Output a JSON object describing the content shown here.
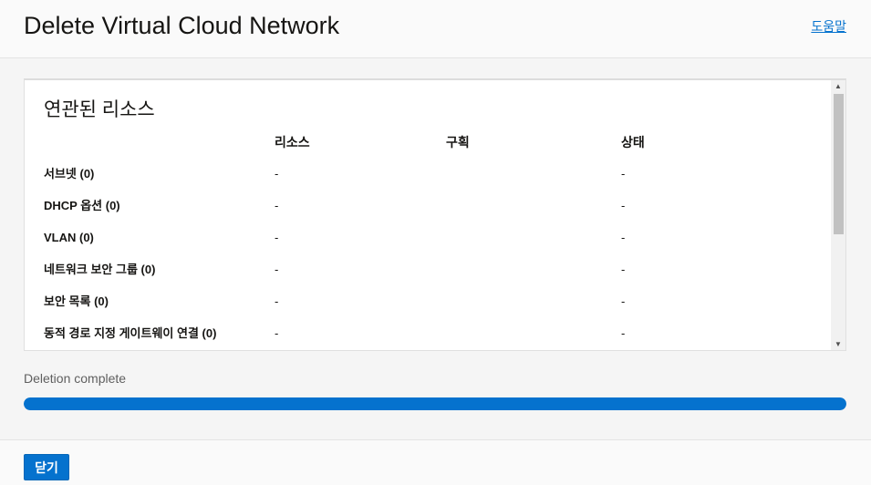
{
  "header": {
    "title": "Delete Virtual Cloud Network",
    "help_label": "도움말"
  },
  "panel": {
    "title": "연관된 리소스",
    "columns": [
      "",
      "리소스",
      "구획",
      "상태"
    ],
    "rows": [
      {
        "name": "서브넷 (0)",
        "resource": "-",
        "compartment": "",
        "status": "-"
      },
      {
        "name": "DHCP 옵션 (0)",
        "resource": "-",
        "compartment": "",
        "status": "-"
      },
      {
        "name": "VLAN (0)",
        "resource": "-",
        "compartment": "",
        "status": "-"
      },
      {
        "name": "네트워크 보안 그룹 (0)",
        "resource": "-",
        "compartment": "",
        "status": "-"
      },
      {
        "name": "보안 목록 (0)",
        "resource": "-",
        "compartment": "",
        "status": "-"
      },
      {
        "name": "동적 경로 지정 게이트웨이 연결 (0)",
        "resource": "-",
        "compartment": "",
        "status": "-"
      }
    ]
  },
  "status": {
    "label": "Deletion complete",
    "progress_percent": 100
  },
  "footer": {
    "close_label": "닫기"
  },
  "colors": {
    "accent": "#0572ce",
    "brand_red": "#c74634"
  }
}
